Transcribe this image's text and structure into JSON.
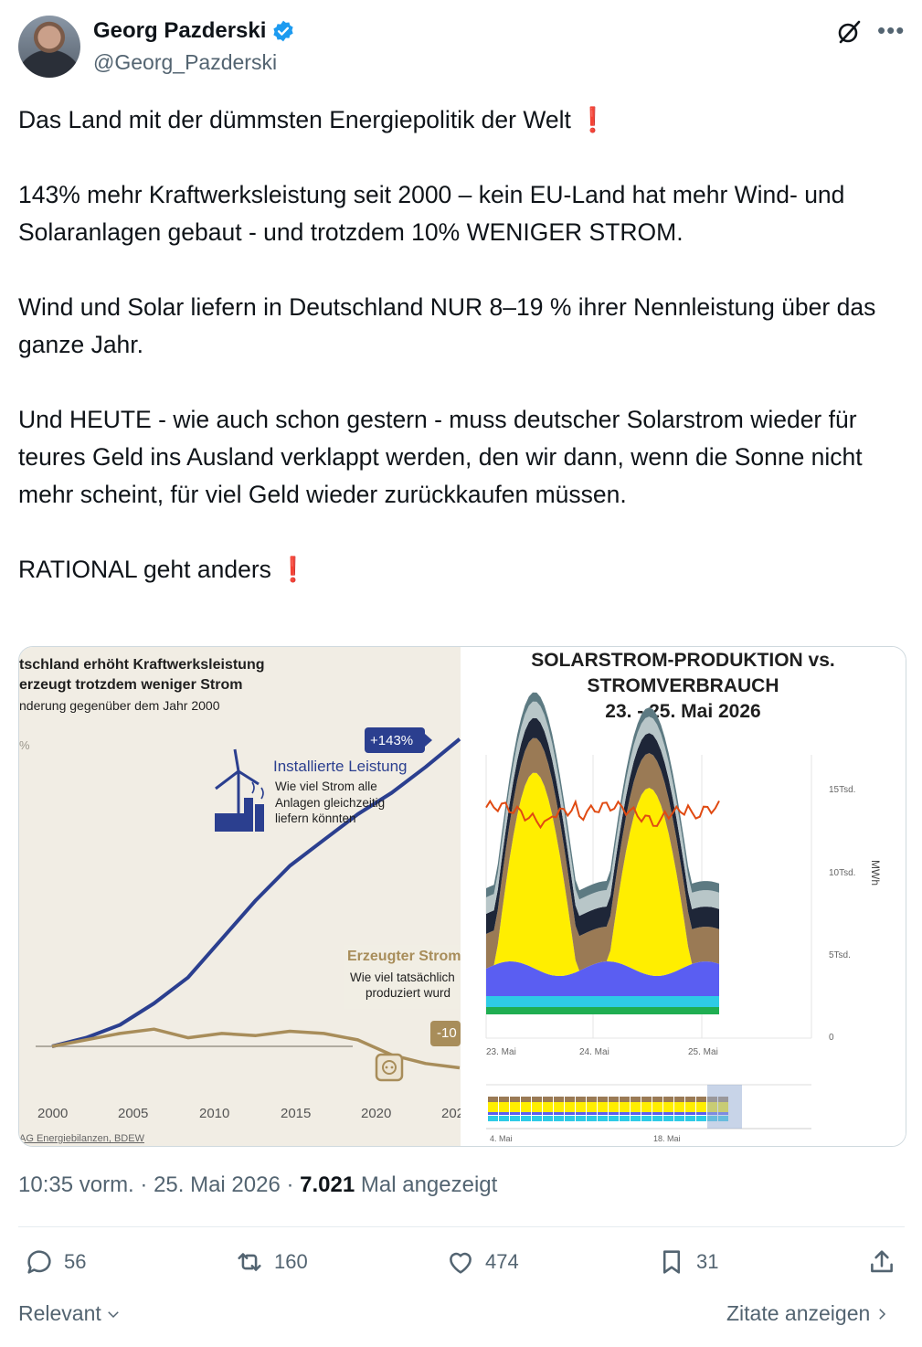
{
  "author": {
    "name": "Georg Pazderski",
    "handle": "@Georg_Pazderski"
  },
  "tweet": {
    "text": "Das Land mit der dümmsten Energiepolitik der Welt ❗\n\n143% mehr Kraftwerksleistung seit 2000 – kein EU-Land hat mehr Wind- und Solaranlagen gebaut - und trotzdem 10% WENIGER STROM.\n\nWind und Solar liefern in Deutschland NUR 8–19 % ihrer Nennleistung über das ganze Jahr.\n\nUnd HEUTE - wie auch schon gestern - muss deutscher Solarstrom wieder für teures Geld ins Ausland verklappt werden, den wir dann, wenn die Sonne nicht mehr scheint, für viel Geld wieder zurückkaufen müssen.\n\nRATIONAL geht anders ❗"
  },
  "left_chart": {
    "title_1": "tschland erhöht Kraftwerksleistung",
    "title_2": "erzeugt trotzdem weniger Strom",
    "subtitle": "nderung gegenüber dem Jahr 2000",
    "unit": "%",
    "badge_up": "+143%",
    "badge_down": "-10",
    "installed_title": "Installierte Leistung",
    "installed_desc_1": "Wie viel Strom alle",
    "installed_desc_2": "Anlagen gleichzeitig",
    "installed_desc_3": "liefern könnten",
    "generated_title": "Erzeugter Strom",
    "generated_desc_1": "Wie viel tatsächlich",
    "generated_desc_2": "produziert wurd",
    "source": "AG Energiebilanzen, BDEW",
    "x_ticks": [
      "2000",
      "2005",
      "2010",
      "2015",
      "2020",
      "202"
    ]
  },
  "chart_data": [
    {
      "type": "line",
      "title": "tschland erhöht Kraftwerksleistung erzeugt trotzdem weniger Strom",
      "subtitle": "nderung gegenüber dem Jahr 2000",
      "x": [
        2000,
        2002,
        2004,
        2006,
        2008,
        2010,
        2012,
        2014,
        2016,
        2018,
        2020,
        2022,
        2024
      ],
      "series": [
        {
          "name": "Installierte Leistung",
          "values": [
            0,
            4,
            10,
            20,
            32,
            50,
            68,
            84,
            96,
            108,
            118,
            130,
            143
          ]
        },
        {
          "name": "Erzeugter Strom",
          "values": [
            0,
            3,
            6,
            8,
            4,
            6,
            5,
            7,
            6,
            3,
            -4,
            -8,
            -10
          ]
        }
      ]
    },
    {
      "type": "area",
      "title": "SOLARSTROM-PRODUKTION vs. STROMVERBRAUCH 23. - 25. Mai 2026",
      "ylabel": "MWh",
      "y_ticks": [
        "15Tsd.",
        "10Tsd.",
        "5Tsd.",
        "0"
      ],
      "x_ticks": [
        "23. Mai",
        "24. Mai",
        "25. Mai"
      ],
      "ylim": [
        0,
        16000
      ]
    }
  ],
  "right_chart": {
    "title_1": "SOLARSTROM-PRODUKTION vs.",
    "title_2": "STROMVERBRAUCH",
    "title_3": "23. - 25. Mai 2026",
    "y_ticks": [
      "15Tsd.",
      "10Tsd.",
      "5Tsd.",
      "0"
    ],
    "y_label": "MWh",
    "x_ticks": [
      "23. Mai",
      "24. Mai",
      "25. Mai"
    ],
    "nav_ticks": [
      "4. Mai",
      "18. Mai"
    ]
  },
  "meta": {
    "time": "10:35 vorm.",
    "date": "25. Mai 2026",
    "views": "7.021",
    "views_label": "Mal angezeigt"
  },
  "actions": {
    "replies": "56",
    "reposts": "160",
    "likes": "474",
    "bookmarks": "31"
  },
  "footer": {
    "sort": "Relevant",
    "quotes": "Zitate anzeigen"
  },
  "colors": {
    "blue_line": "#2b3f8f",
    "brown_line": "#a88d5a",
    "verified": "#1d9bf0",
    "solar": "#ffee00",
    "consumption": "#e04a12"
  }
}
